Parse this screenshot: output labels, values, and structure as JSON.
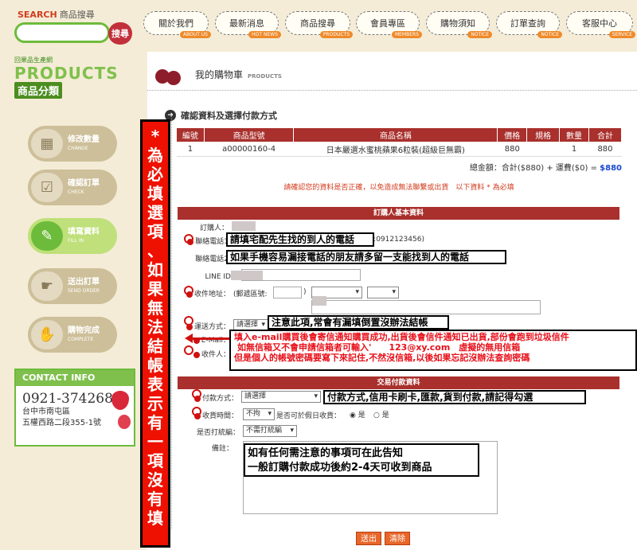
{
  "search": {
    "label": "SEARCH",
    "label_sub": "商品搜尋",
    "button": "搜尋"
  },
  "products_logo": {
    "tag": "回果品生產網",
    "en": "PRODUCTS",
    "zh": "商品分類"
  },
  "steps": [
    {
      "zh": "修改數量",
      "en": "CHANGE",
      "icon": "calculator-icon"
    },
    {
      "zh": "確認訂單",
      "en": "CHECK",
      "icon": "checkbox-icon"
    },
    {
      "zh": "填寫資料",
      "en": "FILL IN",
      "icon": "pen-icon"
    },
    {
      "zh": "送出訂單",
      "en": "SEND ORDER",
      "icon": "hand-icon"
    },
    {
      "zh": "購物完成",
      "en": "COMPLETE",
      "icon": "handshake-icon"
    }
  ],
  "contact": {
    "title": "CONTACT INFO",
    "phone": "0921-374268",
    "addr1": "台中市南屯區",
    "addr2": "五權西路二段355-1號"
  },
  "nav": [
    {
      "label": "關於我們",
      "badge": "ABOUT US"
    },
    {
      "label": "最新消息",
      "badge": "HOT NEWS"
    },
    {
      "label": "商品搜尋",
      "badge": "PRODUCTS"
    },
    {
      "label": "會員專區",
      "badge": "MEMBERS"
    },
    {
      "label": "購物須知",
      "badge": "NOTICE"
    },
    {
      "label": "訂單查詢",
      "badge": "NOTICE"
    },
    {
      "label": "客服中心",
      "badge": "SERVICE"
    }
  ],
  "cart": {
    "title": "我的購物車",
    "title_en": "PRODUCTS"
  },
  "section_title": "確認資料及選擇付款方式",
  "order_table": {
    "headers": [
      "編號",
      "商品型號",
      "商品名稱",
      "價格",
      "規格",
      "數量",
      "合計"
    ],
    "rows": [
      [
        "1",
        "a00000160-4",
        "日本嚴選水蜜桃蘋果6粒裝(超級巨無霸)",
        "880",
        "",
        "1",
        "880"
      ]
    ]
  },
  "total": {
    "text": "總金額：合計($880) + 運費($0) = ",
    "amount": "$880"
  },
  "confirm_note": "請確認您的資料是否正確，以免造成無法聯繫或出貨　以下資料 * 為必填",
  "buyer": {
    "bar": "訂購人基本資料",
    "orderer_label": "訂購人：",
    "phone1_label": "聯絡電話1",
    "phone1_hint": "X:0912123456)",
    "phone2_label": "聯絡電話2",
    "line_label": "LINE ID：",
    "address_label": "收件地址：",
    "zip_label": "(郵遞區號:",
    "zip_close": ")",
    "delivery_label": "運送方式：",
    "delivery_value": "請選擇",
    "email_label": "E-Mail：",
    "receiver_label": "收件人："
  },
  "payment": {
    "bar": "交易付款資料",
    "method_label": "付款方式：",
    "method_value": "請選擇",
    "time_label": "收貨時間：",
    "time_value": "不拘",
    "holiday_label": "是否可於假日收貨：",
    "yes": "是",
    "no": "是",
    "pack_label": "是否打統編：",
    "pack_value": "不需打統編",
    "note_label": "備註："
  },
  "buttons": {
    "submit": "送出",
    "clear": "清除"
  },
  "annotations": {
    "vertical": [
      "*",
      "為",
      "必",
      "填",
      "選",
      "項",
      "、",
      "如",
      "果",
      "無",
      "法",
      "結",
      "帳",
      "表",
      "示",
      "有",
      "一",
      "項",
      "沒",
      "有",
      "填"
    ],
    "phone1": "請填宅配先生找的到人的電話",
    "phone2": "如果手機容易漏接電話的朋友請多留一支能找到人的電話",
    "delivery": "注意此項,常會有漏填倒置沒辦法結帳",
    "email_line1": "填入e-mail購買後會寄信通知購買成功,出貨後會信件通知已出貨,部份會跑到垃圾信件",
    "email_line2": "如無信箱又不會申請信箱者可輸入'　　123@xy.com　虛擬的無用信箱",
    "email_line3": "但是個人的帳號密碼要寫下來記住,不然沒信箱,以後如果忘記沒辦法查詢密碼",
    "payment": "付款方式,信用卡刷卡,匯款,貨到付款,請記得勾選",
    "note_line1": "如有任何需注意的事項可在此告知",
    "note_line2": "一般訂購付款成功後約2-4天可收到商品"
  }
}
